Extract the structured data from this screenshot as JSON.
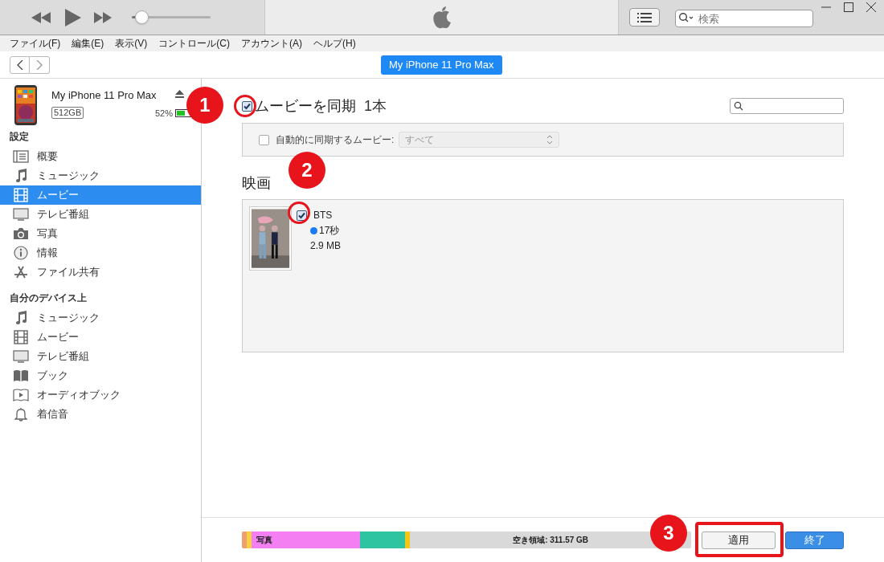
{
  "toolbar": {
    "volume": {
      "level": 0.12
    },
    "search": {
      "placeholder": "検索"
    }
  },
  "menu": [
    "ファイル(F)",
    "編集(E)",
    "表示(V)",
    "コントロール(C)",
    "アカウント(A)",
    "ヘルプ(H)"
  ],
  "device_tab": {
    "label": "My iPhone 11 Pro Max",
    "selected": true
  },
  "device": {
    "name": "My iPhone 11 Pro Max",
    "capacity": "512GB",
    "battery": "52%"
  },
  "sidebar": {
    "sections": [
      {
        "header": "設定",
        "items": [
          {
            "label": "概要",
            "kind": "summary",
            "selected": false
          },
          {
            "label": "ミュージック",
            "kind": "music",
            "selected": false
          },
          {
            "label": "ムービー",
            "kind": "film",
            "selected": true
          },
          {
            "label": "テレビ番組",
            "kind": "tv",
            "selected": false
          },
          {
            "label": "写真",
            "kind": "camera",
            "selected": false
          },
          {
            "label": "情報",
            "kind": "info",
            "selected": false
          },
          {
            "label": "ファイル共有",
            "kind": "apps",
            "selected": false
          }
        ]
      },
      {
        "header": "自分のデバイス上",
        "items": [
          {
            "label": "ミュージック",
            "kind": "music",
            "selected": false
          },
          {
            "label": "ムービー",
            "kind": "film",
            "selected": false
          },
          {
            "label": "テレビ番組",
            "kind": "tv",
            "selected": false
          },
          {
            "label": "ブック",
            "kind": "book",
            "selected": false
          },
          {
            "label": "オーディオブック",
            "kind": "audiobook",
            "selected": false
          },
          {
            "label": "着信音",
            "kind": "bell",
            "selected": false
          }
        ]
      }
    ]
  },
  "sync": {
    "checked": true,
    "title": "ムービーを同期",
    "count": "1本",
    "auto": {
      "checked": false,
      "label": "自動的に同期するムービー:",
      "value": "すべて"
    }
  },
  "movies": {
    "heading": "映画",
    "items": [
      {
        "title": "BTS",
        "checked": true,
        "unwatched": true,
        "duration": "17秒",
        "size": "2.9 MB"
      }
    ]
  },
  "storage": {
    "segments": [
      {
        "color": "#f0a070"
      },
      {
        "color": "#f5d040"
      },
      {
        "label": "写真",
        "color": "#f47ff2"
      },
      {
        "color": "#2ec4a2"
      },
      {
        "color": "#f5c518"
      },
      {
        "label": "空き領域: 311.57 GB",
        "color": "#d9d9d9"
      }
    ]
  },
  "buttons": [
    {
      "label": "適用",
      "kind": "default"
    },
    {
      "label": "終了",
      "kind": "primary"
    }
  ],
  "annotations": [
    {
      "number": "1"
    },
    {
      "number": "2"
    },
    {
      "number": "3"
    }
  ]
}
